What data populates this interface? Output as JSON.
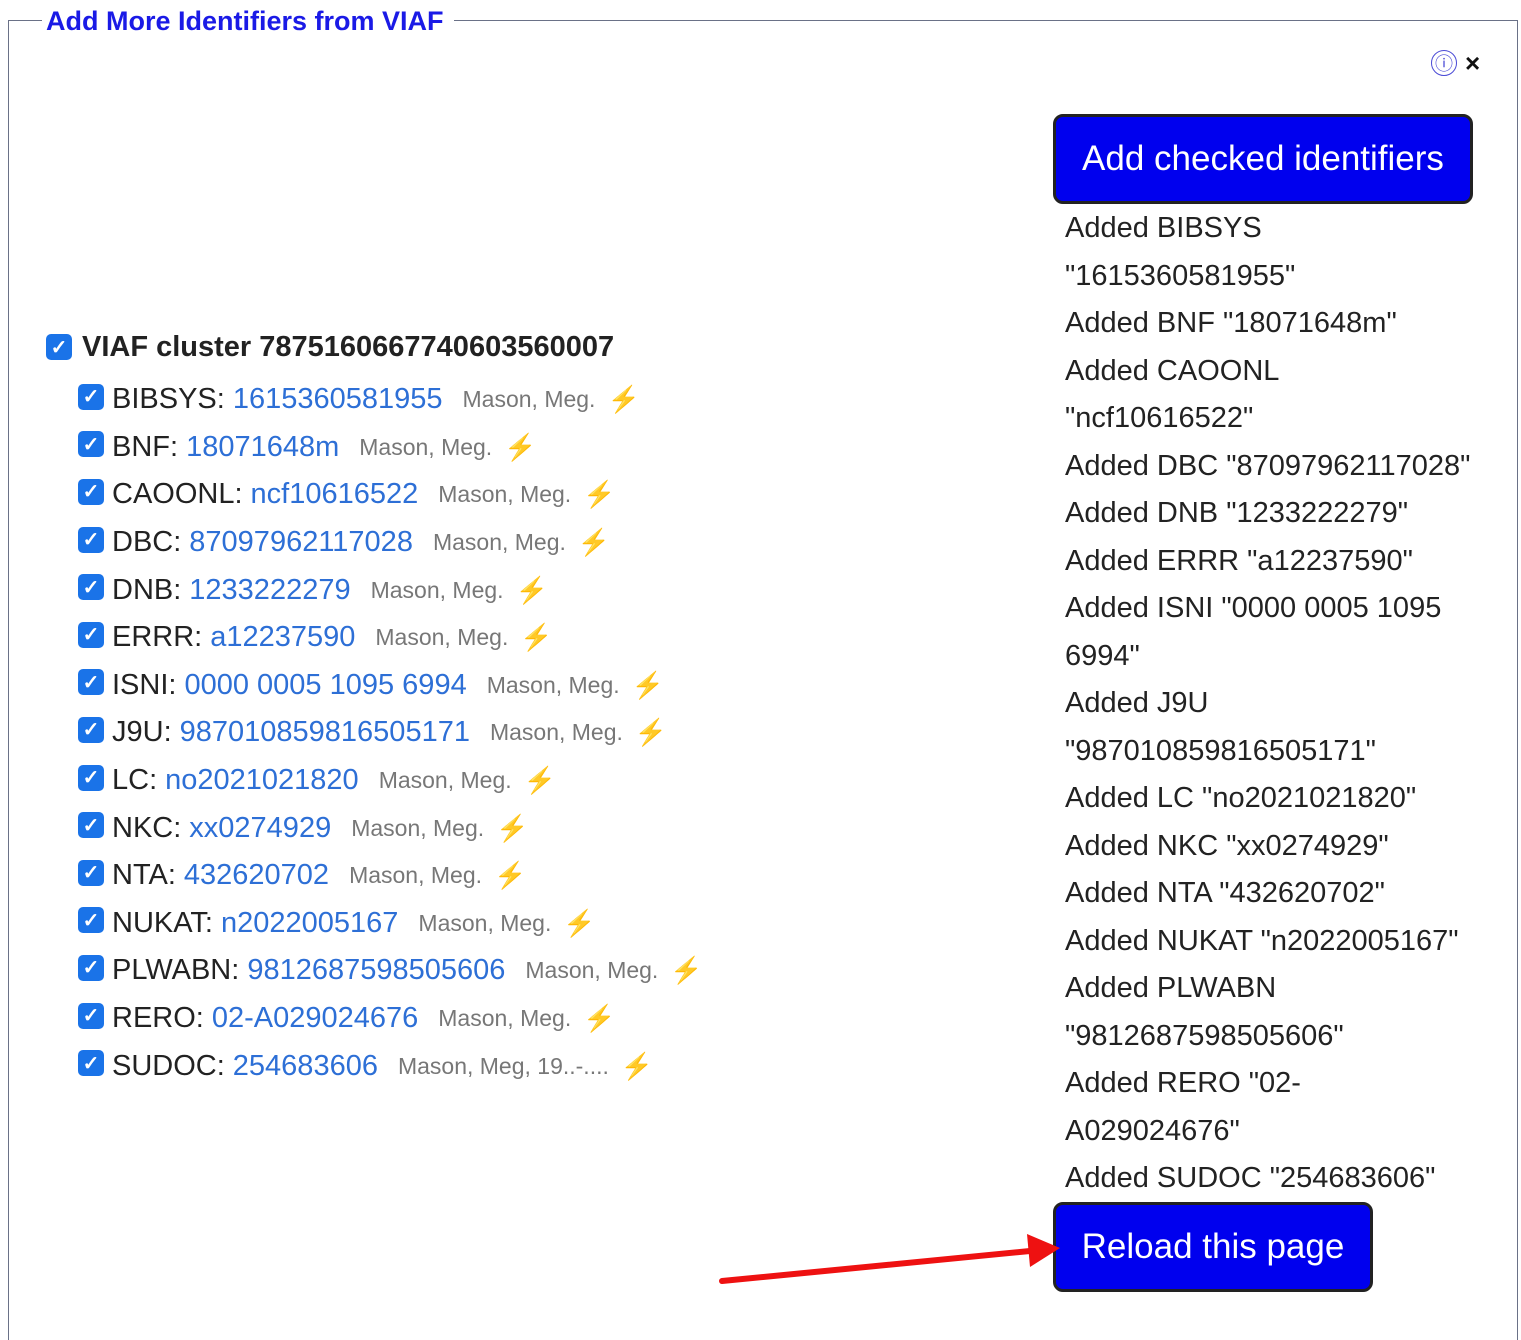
{
  "panel": {
    "title": "Add More Identifiers from VIAF"
  },
  "icons": {
    "info": "ⓘ",
    "close": "×",
    "checkbox": "✓",
    "bolt": "⚡"
  },
  "cluster": {
    "label": "VIAF cluster 7875160667740603560007",
    "checked": true
  },
  "identifiers": [
    {
      "source": "BIBSYS:",
      "value": "1615360581955",
      "name": "Mason, Meg.",
      "checked": true
    },
    {
      "source": "BNF:",
      "value": "18071648m",
      "name": "Mason, Meg.",
      "checked": true
    },
    {
      "source": "CAOONL:",
      "value": "ncf10616522",
      "name": "Mason, Meg.",
      "checked": true
    },
    {
      "source": "DBC:",
      "value": "87097962117028",
      "name": "Mason, Meg.",
      "checked": true
    },
    {
      "source": "DNB:",
      "value": "1233222279",
      "name": "Mason, Meg.",
      "checked": true
    },
    {
      "source": "ERRR:",
      "value": "a12237590",
      "name": "Mason, Meg.",
      "checked": true
    },
    {
      "source": "ISNI:",
      "value": "0000 0005 1095 6994",
      "name": "Mason, Meg.",
      "checked": true
    },
    {
      "source": "J9U:",
      "value": "987010859816505171",
      "name": "Mason, Meg.",
      "checked": true
    },
    {
      "source": "LC:",
      "value": "no2021021820",
      "name": "Mason, Meg.",
      "checked": true
    },
    {
      "source": "NKC:",
      "value": "xx0274929",
      "name": "Mason, Meg.",
      "checked": true
    },
    {
      "source": "NTA:",
      "value": "432620702",
      "name": "Mason, Meg.",
      "checked": true
    },
    {
      "source": "NUKAT:",
      "value": "n2022005167",
      "name": "Mason, Meg.",
      "checked": true
    },
    {
      "source": "PLWABN:",
      "value": "9812687598505606",
      "name": "Mason, Meg.",
      "checked": true
    },
    {
      "source": "RERO:",
      "value": "02-A029024676",
      "name": "Mason, Meg.",
      "checked": true
    },
    {
      "source": "SUDOC:",
      "value": "254683606",
      "name": "Mason, Meg, 19..-....",
      "checked": true
    }
  ],
  "buttons": {
    "add": "Add checked identifiers",
    "reload": "Reload this page"
  },
  "log": [
    "Added BIBSYS",
    "\"1615360581955\"",
    "Added BNF \"18071648m\"",
    "Added CAOONL",
    "\"ncf10616522\"",
    "Added DBC \"87097962117028\"",
    "Added DNB \"1233222279\"",
    "Added ERRR \"a12237590\"",
    "Added ISNI \"0000 0005 1095",
    "6994\"",
    "Added J9U",
    "\"987010859816505171\"",
    "Added LC \"no2021021820\"",
    "Added NKC \"xx0274929\"",
    "Added NTA \"432620702\"",
    "Added NUKAT \"n2022005167\"",
    "Added PLWABN",
    "\"9812687598505606\"",
    "Added RERO \"02-",
    "A029024676\"",
    "Added SUDOC \"254683606\""
  ],
  "colors": {
    "accent": "#0000ee",
    "link": "#2d6fd6",
    "title": "#1a1ae6",
    "bolt": "#f5b400",
    "annotation_arrow": "#ee1111"
  }
}
